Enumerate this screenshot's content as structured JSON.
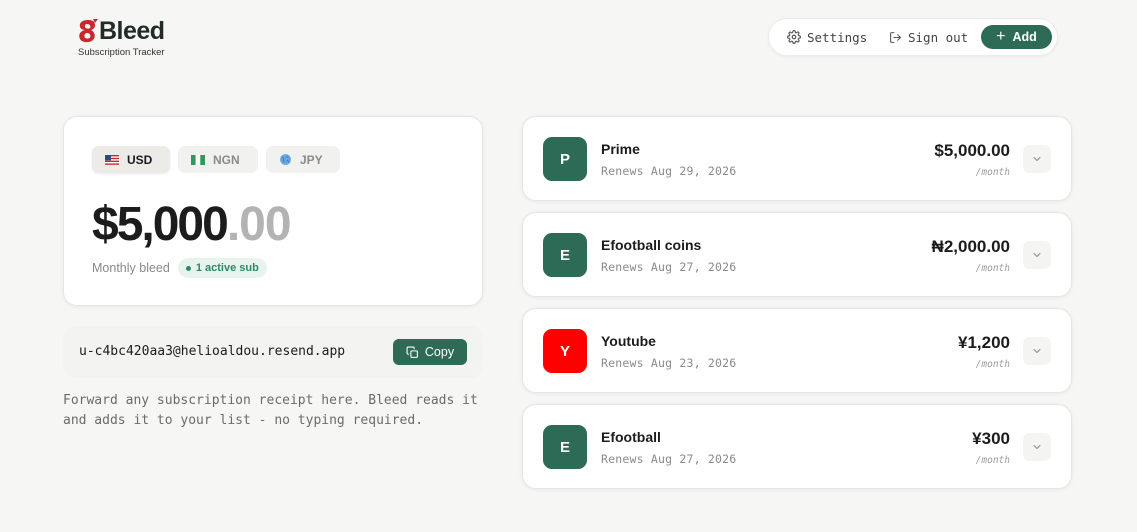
{
  "brand": {
    "name": "Bleed",
    "tagline": "Subscription Tracker"
  },
  "nav": {
    "settings_label": "Settings",
    "signout_label": "Sign out",
    "add_label": "Add"
  },
  "summary": {
    "currencies": [
      {
        "code": "USD",
        "flag": "us-flag",
        "active": true
      },
      {
        "code": "NGN",
        "flag": "ng-flag",
        "active": false
      },
      {
        "code": "JPY",
        "flag": "globe-icon",
        "active": false
      }
    ],
    "amount_main": "$5,000",
    "amount_cents": ".00",
    "label": "Monthly bleed",
    "active_badge": "1 active sub"
  },
  "email": {
    "address": "u-c4bc420aa3@helioaldou.resend.app",
    "copy_label": "Copy",
    "helper": "Forward any subscription receipt here. Bleed reads it and adds it to your list - no typing required."
  },
  "subscriptions": [
    {
      "initial": "P",
      "name": "Prime",
      "renews": "Renews Aug 29, 2026",
      "amount": "$5,000.00",
      "period": "/month",
      "color": "#2d6b56"
    },
    {
      "initial": "E",
      "name": "Efootball coins",
      "renews": "Renews Aug 27, 2026",
      "amount": "₦2,000.00",
      "period": "/month",
      "color": "#2d6b56"
    },
    {
      "initial": "Y",
      "name": "Youtube",
      "renews": "Renews Aug 23, 2026",
      "amount": "¥1,200",
      "period": "/month",
      "color": "#ff0000"
    },
    {
      "initial": "E",
      "name": "Efootball",
      "renews": "Renews Aug 27, 2026",
      "amount": "¥300",
      "period": "/month",
      "color": "#2d6b56"
    }
  ],
  "colors": {
    "accent": "#2d6b56",
    "background": "#f6f6f4",
    "youtube": "#ff0000",
    "badge_text": "#2d8a64"
  }
}
